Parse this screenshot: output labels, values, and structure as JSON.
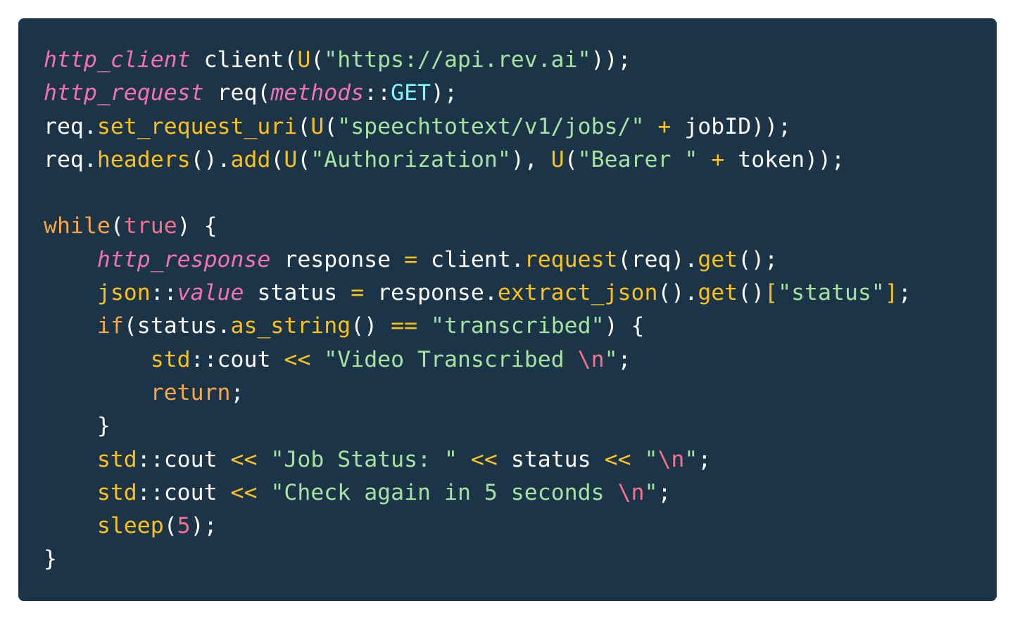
{
  "colors": {
    "background": "#1b3448",
    "default": "#ffffff",
    "type": "#f471b5",
    "function": "#fcc21b",
    "string": "#a6e3a1",
    "keyword": "#f7a64b",
    "constant": "#7ef9ff",
    "escape": "#f7708e",
    "number": "#f7708e",
    "bracket": "#fcc21b",
    "operator": "#fcc21b"
  },
  "code": {
    "language": "cpp",
    "lines": [
      {
        "tokens": [
          {
            "t": "http_client",
            "k": "type",
            "i": true
          },
          {
            "t": " client(",
            "k": "default"
          },
          {
            "t": "U",
            "k": "function"
          },
          {
            "t": "(",
            "k": "default"
          },
          {
            "t": "\"https://api.rev.ai\"",
            "k": "string"
          },
          {
            "t": "));",
            "k": "default"
          }
        ]
      },
      {
        "tokens": [
          {
            "t": "http_request",
            "k": "type",
            "i": true
          },
          {
            "t": " req(",
            "k": "default"
          },
          {
            "t": "methods",
            "k": "type",
            "i": true
          },
          {
            "t": "::",
            "k": "default"
          },
          {
            "t": "GET",
            "k": "constant"
          },
          {
            "t": ");",
            "k": "default"
          }
        ]
      },
      {
        "tokens": [
          {
            "t": "req.",
            "k": "default"
          },
          {
            "t": "set_request_uri",
            "k": "function"
          },
          {
            "t": "(",
            "k": "default"
          },
          {
            "t": "U",
            "k": "function"
          },
          {
            "t": "(",
            "k": "default"
          },
          {
            "t": "\"speechtotext/v1/jobs/\"",
            "k": "string"
          },
          {
            "t": " ",
            "k": "default"
          },
          {
            "t": "+",
            "k": "operator"
          },
          {
            "t": " jobID));",
            "k": "default"
          }
        ]
      },
      {
        "tokens": [
          {
            "t": "req.",
            "k": "default"
          },
          {
            "t": "headers",
            "k": "function"
          },
          {
            "t": "().",
            "k": "default"
          },
          {
            "t": "add",
            "k": "function"
          },
          {
            "t": "(",
            "k": "default"
          },
          {
            "t": "U",
            "k": "function"
          },
          {
            "t": "(",
            "k": "default"
          },
          {
            "t": "\"Authorization\"",
            "k": "string"
          },
          {
            "t": "), ",
            "k": "default"
          },
          {
            "t": "U",
            "k": "function"
          },
          {
            "t": "(",
            "k": "default"
          },
          {
            "t": "\"Bearer \"",
            "k": "string"
          },
          {
            "t": " ",
            "k": "default"
          },
          {
            "t": "+",
            "k": "operator"
          },
          {
            "t": " token));",
            "k": "default"
          }
        ]
      },
      {
        "tokens": []
      },
      {
        "tokens": [
          {
            "t": "while",
            "k": "keyword"
          },
          {
            "t": "(",
            "k": "default"
          },
          {
            "t": "true",
            "k": "escape"
          },
          {
            "t": ") {",
            "k": "default"
          }
        ]
      },
      {
        "tokens": [
          {
            "t": "    ",
            "k": "default"
          },
          {
            "t": "http_response",
            "k": "type",
            "i": true
          },
          {
            "t": " response ",
            "k": "default"
          },
          {
            "t": "=",
            "k": "operator"
          },
          {
            "t": " client.",
            "k": "default"
          },
          {
            "t": "request",
            "k": "function"
          },
          {
            "t": "(req).",
            "k": "default"
          },
          {
            "t": "get",
            "k": "function"
          },
          {
            "t": "();",
            "k": "default"
          }
        ]
      },
      {
        "tokens": [
          {
            "t": "    ",
            "k": "default"
          },
          {
            "t": "json",
            "k": "function"
          },
          {
            "t": "::",
            "k": "default"
          },
          {
            "t": "value",
            "k": "type",
            "i": true
          },
          {
            "t": " status ",
            "k": "default"
          },
          {
            "t": "=",
            "k": "operator"
          },
          {
            "t": " response.",
            "k": "default"
          },
          {
            "t": "extract_json",
            "k": "function"
          },
          {
            "t": "().",
            "k": "default"
          },
          {
            "t": "get",
            "k": "function"
          },
          {
            "t": "()",
            "k": "default"
          },
          {
            "t": "[",
            "k": "bracket"
          },
          {
            "t": "\"status\"",
            "k": "string"
          },
          {
            "t": "]",
            "k": "bracket"
          },
          {
            "t": ";",
            "k": "default"
          }
        ]
      },
      {
        "tokens": [
          {
            "t": "    ",
            "k": "default"
          },
          {
            "t": "if",
            "k": "keyword"
          },
          {
            "t": "(status.",
            "k": "default"
          },
          {
            "t": "as_string",
            "k": "function"
          },
          {
            "t": "() ",
            "k": "default"
          },
          {
            "t": "==",
            "k": "operator"
          },
          {
            "t": " ",
            "k": "default"
          },
          {
            "t": "\"transcribed\"",
            "k": "string"
          },
          {
            "t": ") {",
            "k": "default"
          }
        ]
      },
      {
        "tokens": [
          {
            "t": "        ",
            "k": "default"
          },
          {
            "t": "std",
            "k": "function"
          },
          {
            "t": "::cout ",
            "k": "default"
          },
          {
            "t": "<<",
            "k": "operator"
          },
          {
            "t": " ",
            "k": "default"
          },
          {
            "t": "\"Video Transcribed ",
            "k": "string"
          },
          {
            "t": "\\n",
            "k": "escape"
          },
          {
            "t": "\"",
            "k": "string"
          },
          {
            "t": ";",
            "k": "default"
          }
        ]
      },
      {
        "tokens": [
          {
            "t": "        ",
            "k": "default"
          },
          {
            "t": "return",
            "k": "keyword"
          },
          {
            "t": ";",
            "k": "default"
          }
        ]
      },
      {
        "tokens": [
          {
            "t": "    }",
            "k": "default"
          }
        ]
      },
      {
        "tokens": [
          {
            "t": "    ",
            "k": "default"
          },
          {
            "t": "std",
            "k": "function"
          },
          {
            "t": "::cout ",
            "k": "default"
          },
          {
            "t": "<<",
            "k": "operator"
          },
          {
            "t": " ",
            "k": "default"
          },
          {
            "t": "\"Job Status: \"",
            "k": "string"
          },
          {
            "t": " ",
            "k": "default"
          },
          {
            "t": "<<",
            "k": "operator"
          },
          {
            "t": " status ",
            "k": "default"
          },
          {
            "t": "<<",
            "k": "operator"
          },
          {
            "t": " ",
            "k": "default"
          },
          {
            "t": "\"",
            "k": "string"
          },
          {
            "t": "\\n",
            "k": "escape"
          },
          {
            "t": "\"",
            "k": "string"
          },
          {
            "t": ";",
            "k": "default"
          }
        ]
      },
      {
        "tokens": [
          {
            "t": "    ",
            "k": "default"
          },
          {
            "t": "std",
            "k": "function"
          },
          {
            "t": "::cout ",
            "k": "default"
          },
          {
            "t": "<<",
            "k": "operator"
          },
          {
            "t": " ",
            "k": "default"
          },
          {
            "t": "\"Check again in 5 seconds ",
            "k": "string"
          },
          {
            "t": "\\n",
            "k": "escape"
          },
          {
            "t": "\"",
            "k": "string"
          },
          {
            "t": ";",
            "k": "default"
          }
        ]
      },
      {
        "tokens": [
          {
            "t": "    ",
            "k": "default"
          },
          {
            "t": "sleep",
            "k": "function"
          },
          {
            "t": "(",
            "k": "default"
          },
          {
            "t": "5",
            "k": "number"
          },
          {
            "t": ");",
            "k": "default"
          }
        ]
      },
      {
        "tokens": [
          {
            "t": "}",
            "k": "default"
          }
        ]
      }
    ]
  }
}
